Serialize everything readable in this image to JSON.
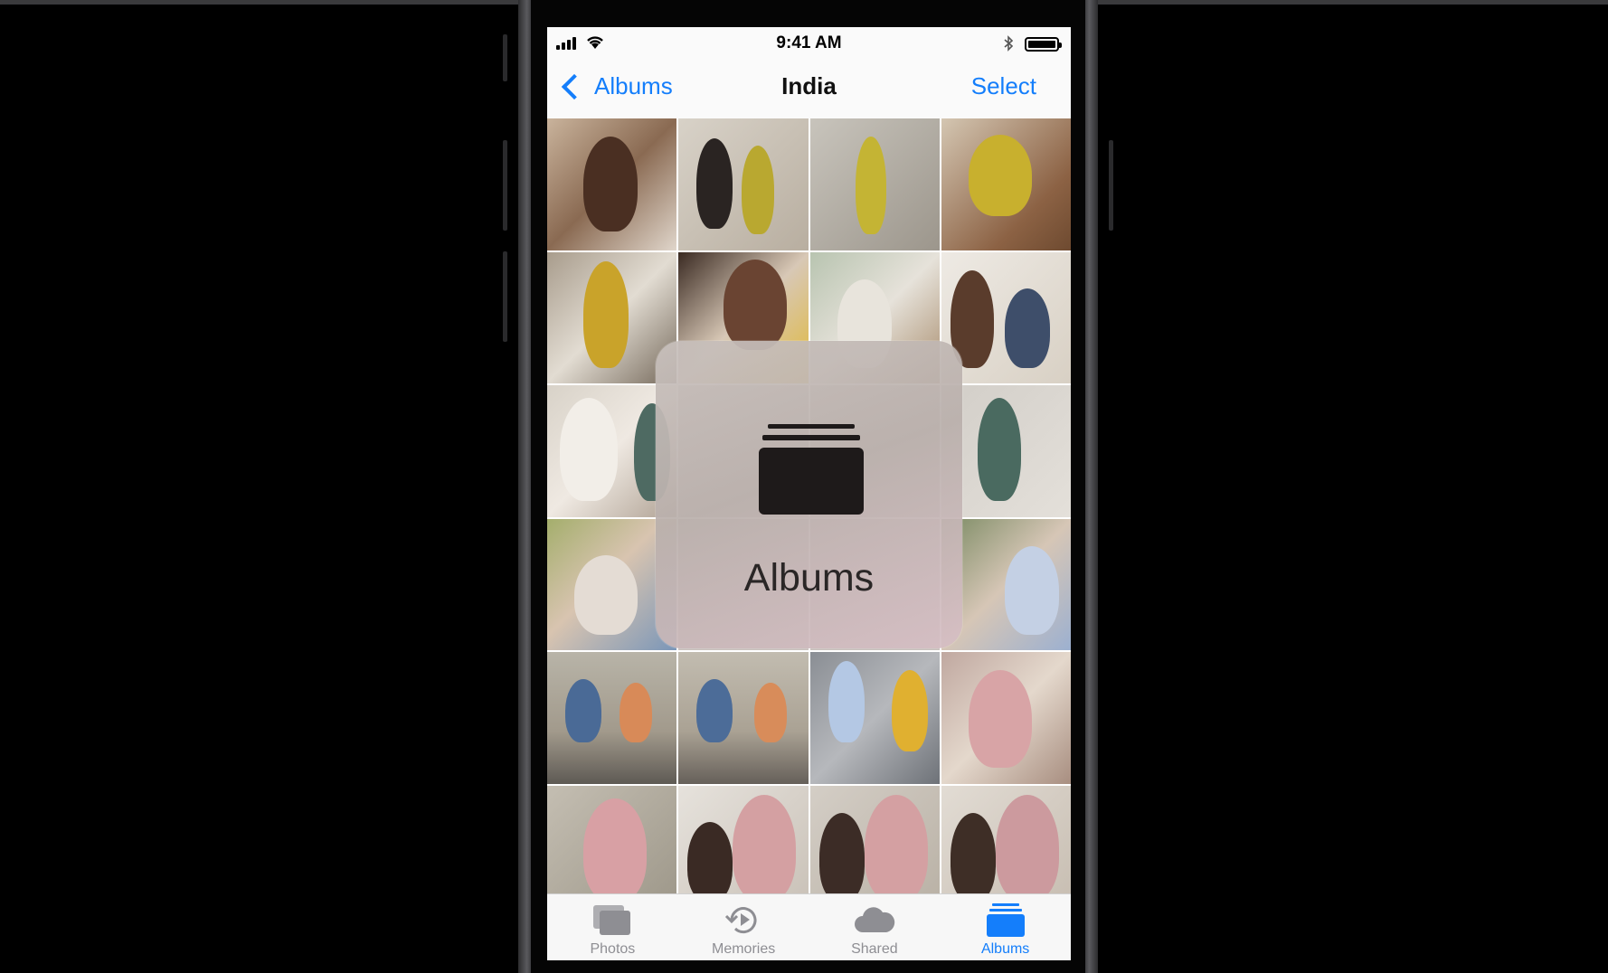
{
  "status_bar": {
    "time": "9:41 AM"
  },
  "nav": {
    "back_label": "Albums",
    "title": "India",
    "action_label": "Select"
  },
  "hud": {
    "label": "Albums",
    "icon": "albums-stack-icon"
  },
  "tabs": [
    {
      "label": "Photos",
      "icon": "photos-icon",
      "active": false
    },
    {
      "label": "Memories",
      "icon": "memories-icon",
      "active": false
    },
    {
      "label": "Shared",
      "icon": "cloud-icon",
      "active": false
    },
    {
      "label": "Albums",
      "icon": "albums-icon",
      "active": true
    }
  ],
  "colors": {
    "accent": "#147efb",
    "inactive": "#8e8e93"
  },
  "photo_count_visible": 24
}
